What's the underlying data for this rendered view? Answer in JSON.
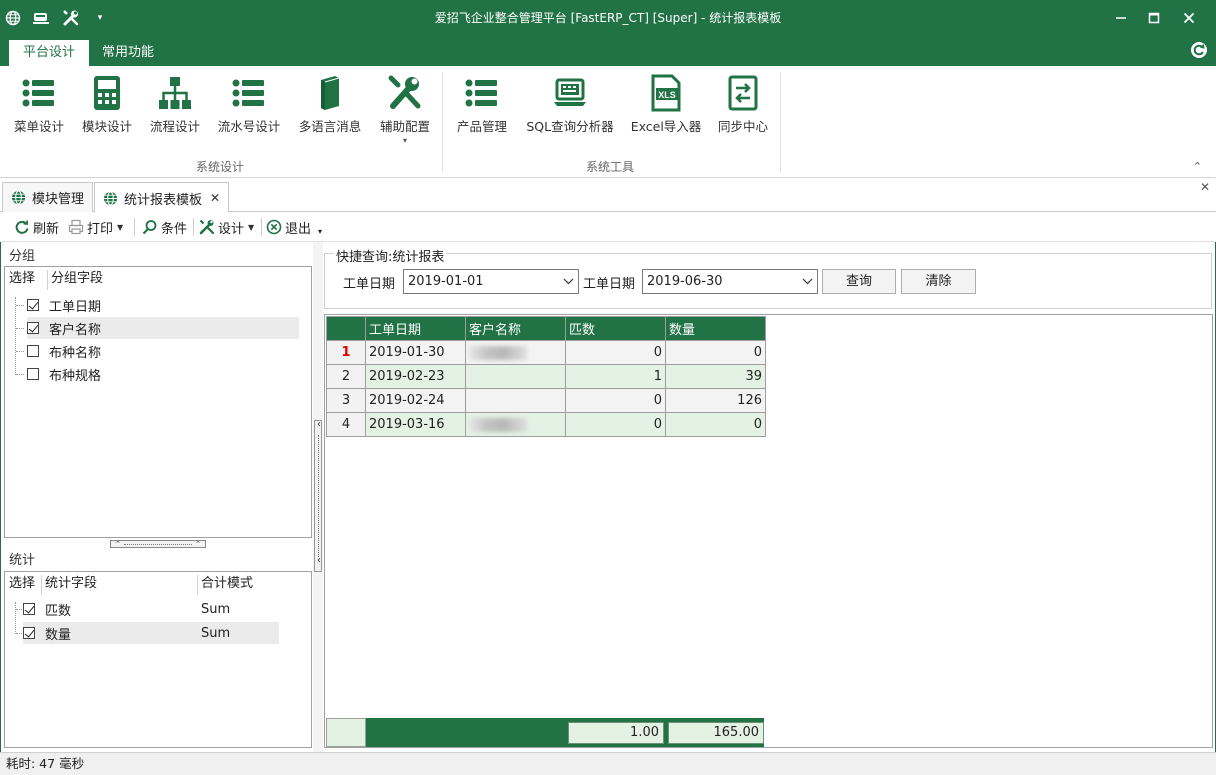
{
  "window": {
    "title": "爱招飞企业整合管理平台 [FastERP_CT] [Super] - 统计报表模板",
    "quick_access": [
      "globe-icon",
      "eraser-icon",
      "tools-icon",
      "dropdown-arrow"
    ],
    "controls": [
      "minimize",
      "maximize",
      "close"
    ]
  },
  "ribbon": {
    "tabs": [
      {
        "label": "平台设计",
        "active": true
      },
      {
        "label": "常用功能",
        "active": false
      }
    ],
    "groups": [
      {
        "label": "系统设计",
        "buttons": [
          {
            "label": "菜单设计",
            "icon": "list-icon"
          },
          {
            "label": "模块设计",
            "icon": "calculator-icon"
          },
          {
            "label": "流程设计",
            "icon": "hierarchy-icon"
          },
          {
            "label": "流水号设计",
            "icon": "list-icon"
          },
          {
            "label": "多语言消息",
            "icon": "book-icon"
          },
          {
            "label": "辅助配置",
            "icon": "tools-icon",
            "dropdown": true
          }
        ]
      },
      {
        "label": "系统工具",
        "buttons": [
          {
            "label": "产品管理",
            "icon": "list-icon"
          },
          {
            "label": "SQL查询分析器",
            "icon": "laptop-icon"
          },
          {
            "label": "Excel导入器",
            "icon": "xls-icon",
            "icon_text": "XLS"
          },
          {
            "label": "同步中心",
            "icon": "sync-icon"
          }
        ]
      }
    ]
  },
  "doc_tabs": [
    {
      "label": "模块管理",
      "active": false
    },
    {
      "label": "统计报表模板",
      "active": true,
      "closable": true
    }
  ],
  "toolbar": {
    "items": [
      {
        "label": "刷新",
        "icon": "refresh-icon"
      },
      {
        "label": "打印",
        "icon": "printer-icon",
        "dropdown": true
      },
      {
        "label": "条件",
        "icon": "search-icon"
      },
      {
        "label": "设计",
        "icon": "tools-icon",
        "dropdown": true
      },
      {
        "label": "退出",
        "icon": "exit-icon"
      }
    ]
  },
  "group_panel": {
    "title": "分组",
    "headers": [
      "选择",
      "分组字段"
    ],
    "rows": [
      {
        "label": "工单日期",
        "checked": true,
        "selected": false
      },
      {
        "label": "客户名称",
        "checked": true,
        "selected": true
      },
      {
        "label": "布种名称",
        "checked": false,
        "selected": false
      },
      {
        "label": "布种规格",
        "checked": false,
        "selected": false
      }
    ]
  },
  "stats_panel": {
    "title": "统计",
    "headers": [
      "选择",
      "统计字段",
      "合计模式"
    ],
    "rows": [
      {
        "label": "匹数",
        "mode": "Sum",
        "checked": true,
        "selected": false
      },
      {
        "label": "数量",
        "mode": "Sum",
        "checked": true,
        "selected": true
      }
    ]
  },
  "quick_query": {
    "title": "快捷查询:统计报表",
    "from_label": "工单日期",
    "from_value": "2019-01-01",
    "to_label": "工单日期",
    "to_value": "2019-06-30",
    "query_button": "查询",
    "clear_button": "清除"
  },
  "grid": {
    "columns": [
      "工单日期",
      "客户名称",
      "匹数",
      "数量"
    ],
    "rows": [
      {
        "no": "1",
        "date": "2019-01-30",
        "customer": "",
        "pieces": "0",
        "qty": "0",
        "current": true
      },
      {
        "no": "2",
        "date": "2019-02-23",
        "customer": "",
        "pieces": "1",
        "qty": "39",
        "current": false
      },
      {
        "no": "3",
        "date": "2019-02-24",
        "customer": "",
        "pieces": "0",
        "qty": "126",
        "current": false
      },
      {
        "no": "4",
        "date": "2019-03-16",
        "customer": "",
        "pieces": "0",
        "qty": "0",
        "current": false
      }
    ],
    "footer": {
      "pieces": "1.00",
      "qty": "165.00"
    }
  },
  "status": {
    "text": "耗时: 47 毫秒"
  },
  "colors": {
    "brand": "#217346",
    "row_alt": "#e4f2e4",
    "current_row_marker": "#e00000"
  }
}
